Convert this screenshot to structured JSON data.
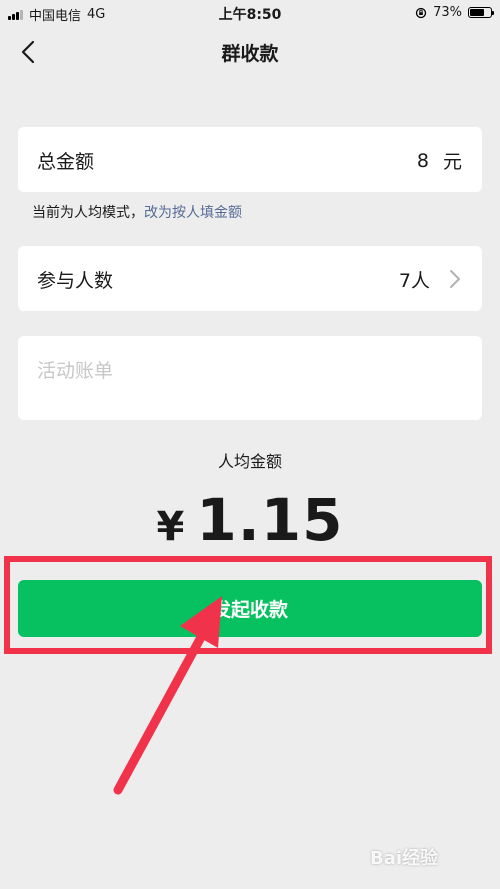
{
  "status_bar": {
    "carrier": "中国电信",
    "network": "4G",
    "time": "上午8:50",
    "battery": "73%",
    "battery_level": 0.73
  },
  "nav": {
    "title": "群收款"
  },
  "total": {
    "label": "总金额",
    "amount": "8",
    "unit": "元"
  },
  "mode": {
    "text": "当前为人均模式，",
    "link": "改为按人填金额"
  },
  "people": {
    "label": "参与人数",
    "value": "7人"
  },
  "bill": {
    "placeholder": "活动账单"
  },
  "per_person": {
    "label": "人均金额",
    "currency": "¥",
    "value": "1.15"
  },
  "submit": {
    "label": "发起收款"
  },
  "watermark": {
    "text": "Bai经验"
  },
  "colors": {
    "primary": "#07C160",
    "link": "#576B95",
    "annotation": "#F0334A",
    "background": "#EDEDED"
  }
}
